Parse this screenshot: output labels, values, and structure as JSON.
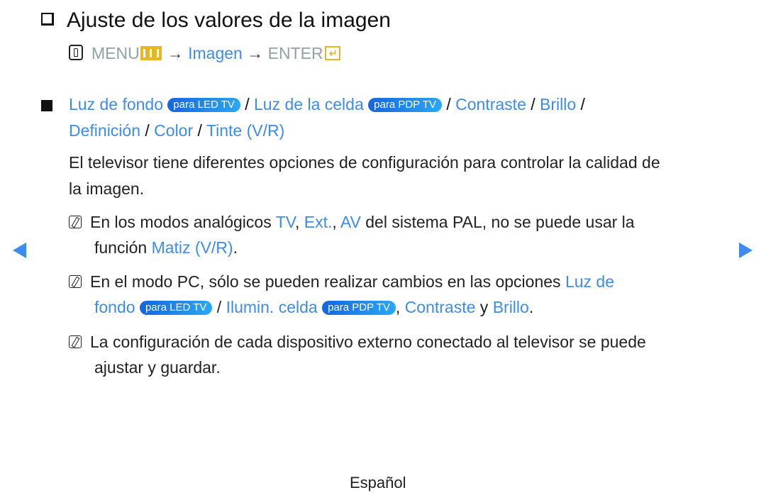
{
  "title": "Ajuste de los valores de la imagen",
  "menu_path": {
    "menu": "MENU",
    "arrow": "→",
    "imagen": "Imagen",
    "enter": "ENTER",
    "enter_glyph": "↵"
  },
  "options": {
    "luz_fondo": "Luz de fondo",
    "badge_led": "para LED TV",
    "slash": "/",
    "luz_celda": "Luz de la celda",
    "badge_pdp": "para PDP TV",
    "contraste": "Contraste",
    "brillo": "Brillo",
    "definicion": "Definición",
    "color": "Color",
    "tinte": "Tinte (V/R)"
  },
  "description": {
    "line1": "El televisor tiene diferentes opciones de configuración para controlar la calidad de",
    "line2": "la imagen."
  },
  "notes": [
    {
      "line1_a": "En los modos analógicos ",
      "tv": "TV",
      "comma1": ", ",
      "ext": "Ext.",
      "comma2": ", ",
      "av": "AV",
      "line1_b": " del sistema PAL, no se puede usar la",
      "line2_a": "función ",
      "matiz": "Matiz (V/R)",
      "line2_b": "."
    },
    {
      "line1_a": "En el modo PC, sólo se pueden realizar cambios en las opciones ",
      "luz_de": "Luz de",
      "fondo": "fondo",
      "badge_led": "para LED TV",
      "slash": " / ",
      "ilumin": "Ilumin. celda",
      "badge_pdp": "para PDP TV",
      "comma": ", ",
      "contraste": "Contraste",
      "y": " y ",
      "brillo": "Brillo",
      "end": "."
    },
    {
      "line1": "La configuración de cada dispositivo externo conectado al televisor se puede",
      "line2": "ajustar y guardar."
    }
  ],
  "footer": "Español",
  "colors": {
    "link": "#3c8cf0",
    "menu_gray": "#8fa3a6",
    "icon_yellow": "#e6b722"
  }
}
